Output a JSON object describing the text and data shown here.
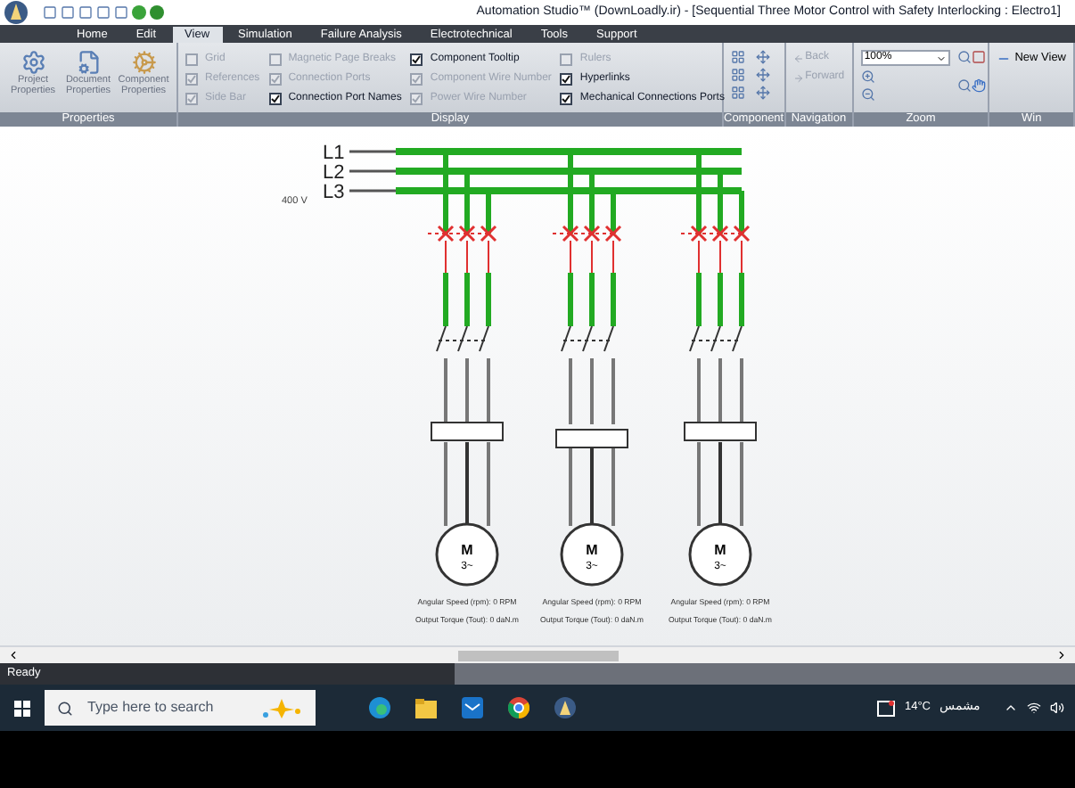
{
  "window": {
    "title": "Automation Studio™ (DownLoadly.ir) - [Sequential Three Motor Control with Safety Interlocking : Electro1]"
  },
  "tabs": [
    {
      "label": "Home",
      "selected": false
    },
    {
      "label": "Edit",
      "selected": false
    },
    {
      "label": "View",
      "selected": true
    },
    {
      "label": "Simulation",
      "selected": false
    },
    {
      "label": "Failure Analysis",
      "selected": false
    },
    {
      "label": "Electrotechnical",
      "selected": false
    },
    {
      "label": "Tools",
      "selected": false
    },
    {
      "label": "Support",
      "selected": false
    }
  ],
  "ribbon": {
    "properties": {
      "title": "Properties",
      "buttons": [
        "Project Properties",
        "Document Properties",
        "Component Properties"
      ]
    },
    "display": {
      "title": "Display",
      "checkboxes": [
        {
          "label": "Grid",
          "checked": false,
          "disabled": true
        },
        {
          "label": "References",
          "checked": true,
          "disabled": true
        },
        {
          "label": "Side Bar",
          "checked": true,
          "disabled": true
        },
        {
          "label": "Magnetic Page Breaks",
          "checked": false,
          "disabled": true
        },
        {
          "label": "Connection Ports",
          "checked": true,
          "disabled": true
        },
        {
          "label": "Connection Port Names",
          "checked": true,
          "disabled": false
        },
        {
          "label": "Component Tooltip",
          "checked": true,
          "disabled": false
        },
        {
          "label": "Component Wire Number",
          "checked": true,
          "disabled": true
        },
        {
          "label": "Power Wire Number",
          "checked": true,
          "disabled": true
        },
        {
          "label": "Rulers",
          "checked": false,
          "disabled": true
        },
        {
          "label": "Hyperlinks",
          "checked": true,
          "disabled": false
        },
        {
          "label": "Mechanical Connections Ports",
          "checked": true,
          "disabled": false
        }
      ]
    },
    "component": {
      "title": "Component"
    },
    "navigation": {
      "title": "Navigation",
      "buttons": [
        "Back",
        "Forward"
      ]
    },
    "zoom": {
      "title": "Zoom",
      "value": "100%"
    },
    "window_group": {
      "title": "Win",
      "button": "New View"
    }
  },
  "diagram": {
    "supply": [
      "L1",
      "L2",
      "L3"
    ],
    "voltage": "400 V",
    "branches": [
      {
        "motor": "M",
        "phases": "3~",
        "speed": "Angular Speed (rpm): 0 RPM",
        "torque": "Output Torque (Tout): 0 daN.m"
      },
      {
        "motor": "M",
        "phases": "3~",
        "speed": "Angular Speed (rpm): 0 RPM",
        "torque": "Output Torque (Tout): 0 daN.m"
      },
      {
        "motor": "M",
        "phases": "3~",
        "speed": "Angular Speed (rpm): 0 RPM",
        "torque": "Output Torque (Tout): 0 daN.m"
      }
    ]
  },
  "status_bar": {
    "text": "Ready"
  },
  "taskbar": {
    "search": {
      "placeholder": "Type here to search"
    },
    "weather": "14°C",
    "condition": "مشمس"
  }
}
